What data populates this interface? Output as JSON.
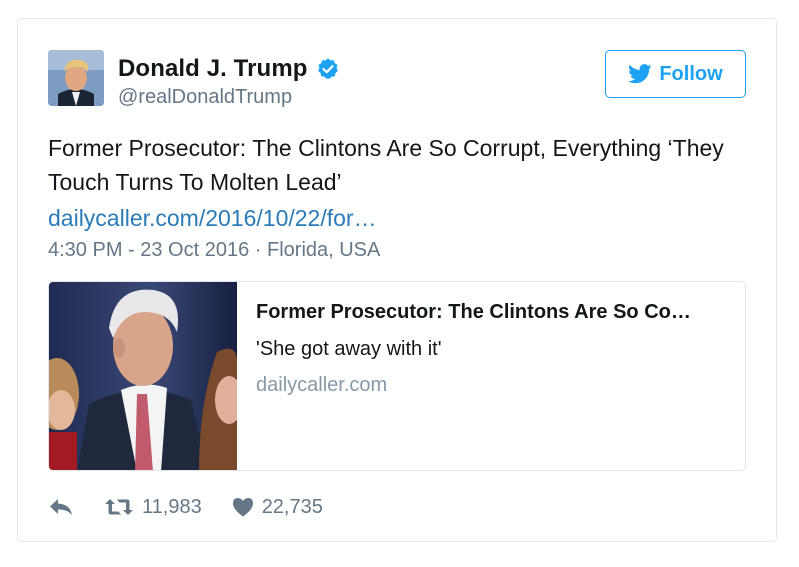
{
  "user": {
    "name": "Donald J. Trump",
    "handle": "@realDonaldTrump",
    "verified": true
  },
  "follow_button": {
    "label": "Follow",
    "icon": "twitter-bird-icon"
  },
  "tweet": {
    "text": "Former Prosecutor: The Clintons Are So Corrupt, Everything ‘They Touch Turns To Molten Lead’",
    "link_text": "dailycaller.com/2016/10/22/for…",
    "timestamp": "4:30 PM - 23 Oct 2016 · Florida, USA"
  },
  "link_card": {
    "title": "Former Prosecutor: The Clintons Are So Co…",
    "description": "'She got away with it'",
    "domain": "dailycaller.com"
  },
  "actions": {
    "reply_icon": "reply-icon",
    "retweet_icon": "retweet-icon",
    "retweet_count": "11,983",
    "like_icon": "heart-icon",
    "like_count": "22,735"
  },
  "colors": {
    "accent": "#1da1f2",
    "link": "#2b7bb9",
    "muted": "#657786",
    "border": "#e1e8ed"
  }
}
